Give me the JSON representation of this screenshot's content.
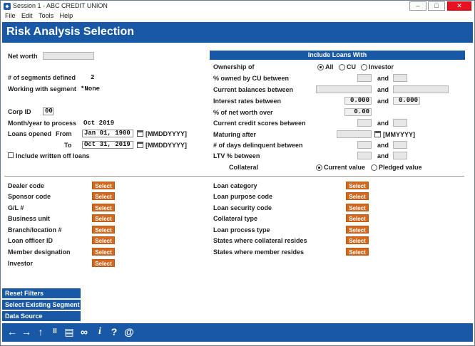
{
  "window": {
    "title": "Session 1 - ABC CREDIT UNION",
    "min": "–",
    "max": "□",
    "close": "✕"
  },
  "menu": [
    "File",
    "Edit",
    "Tools",
    "Help"
  ],
  "header": {
    "title": "Risk Analysis Selection"
  },
  "left": {
    "net_worth_label": "Net worth",
    "segments_label": "# of segments defined",
    "segments_value": "2",
    "working_label": "Working with segment",
    "working_value": "*None",
    "corp_label": "Corp ID",
    "corp_value": "00",
    "month_label": "Month/year to process",
    "month_value": "Oct 2019",
    "opened_label": "Loans opened",
    "from_label": "From",
    "from_value": "Jan 01, 1900",
    "from_fmt": "[MMDDYYYY]",
    "to_label": "To",
    "to_value": "Oct 31, 2019",
    "to_fmt": "[MMDDYYYY]",
    "writeoff_label": "Include written off loans"
  },
  "right": {
    "bar_title": "Include Loans With",
    "ownership_label": "Ownership of",
    "own_all": "All",
    "own_cu": "CU",
    "own_investor": "Investor",
    "owned_label": "% owned by CU between",
    "balances_label": "Current balances between",
    "rates_label": "Interest rates between",
    "rate_from": "0.000",
    "rate_to": "0.000",
    "networth_label": "% of net worth over",
    "networth_value": "0.00",
    "scores_label": "Current credit scores between",
    "maturing_label": "Maturing after",
    "maturing_fmt": "[MMYYYY]",
    "delinq_label": "# of days delinquent between",
    "ltv_label": "LTV % between",
    "collateral_label": "Collateral",
    "current_value": "Current value",
    "pledged_value": "Pledged value",
    "and": "and"
  },
  "select_label": "Select",
  "left_filters": [
    "Dealer code",
    "Sponsor code",
    "G/L #",
    "Business unit",
    "Branch/location #",
    "Loan officer ID",
    "Member designation",
    "Investor"
  ],
  "right_filters": [
    "Loan category",
    "Loan purpose code",
    "Loan security code",
    "Collateral type",
    "Loan process type",
    "States where collateral resides",
    "States where member resides"
  ],
  "side_buttons": [
    "Reset Filters",
    "Select Existing Segment",
    "Data Source"
  ],
  "footer_icons": [
    {
      "name": "back-arrow-icon",
      "glyph": "←"
    },
    {
      "name": "forward-arrow-icon",
      "glyph": "→"
    },
    {
      "name": "up-arrow-icon",
      "glyph": "↑"
    },
    {
      "name": "pause-icon",
      "glyph": "II"
    },
    {
      "name": "print-icon",
      "glyph": "▤"
    },
    {
      "name": "link-icon",
      "glyph": "∞"
    },
    {
      "name": "info-icon",
      "glyph": "i"
    },
    {
      "name": "help-icon",
      "glyph": "?"
    },
    {
      "name": "at-icon",
      "glyph": "@"
    }
  ]
}
